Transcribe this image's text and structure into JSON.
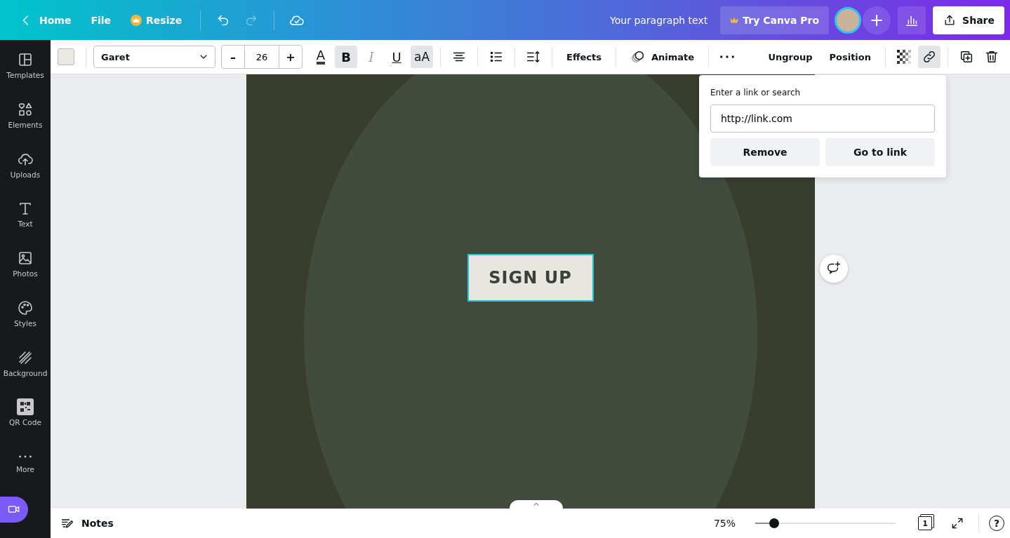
{
  "topbar": {
    "home": "Home",
    "file": "File",
    "resize": "Resize",
    "redo_disabled": true,
    "doc_title": "Your paragraph text",
    "pro_button": "Try Canva Pro",
    "add": "+",
    "share": "Share"
  },
  "sidebar": {
    "items": [
      {
        "label": "Templates"
      },
      {
        "label": "Elements"
      },
      {
        "label": "Uploads"
      },
      {
        "label": "Text"
      },
      {
        "label": "Photos"
      },
      {
        "label": "Styles"
      },
      {
        "label": "Background"
      },
      {
        "label": "QR Code"
      },
      {
        "label": "More"
      }
    ]
  },
  "toolbar": {
    "font": "Garet",
    "size": "26",
    "minus": "–",
    "plus": "+",
    "color_letter": "A",
    "bold": {
      "label": "B",
      "selected": true
    },
    "italic": {
      "label": "I",
      "disabled": true
    },
    "underline": {
      "label": "U",
      "selected": false
    },
    "case": {
      "label": "aA",
      "selected": true
    },
    "effects": "Effects",
    "animate": "Animate",
    "ungroup": "Ungroup",
    "position": "Position",
    "link_selected": true
  },
  "link_popup": {
    "label": "Enter a link or search",
    "value": "http://link.com",
    "buttons": [
      "Remove",
      "Go to link"
    ]
  },
  "canvas": {
    "button_text": "SIGN UP",
    "selected": true
  },
  "bottombar": {
    "notes": "Notes",
    "zoom": "75%",
    "zoom_level": {
      "level": 0.135
    },
    "page": "1",
    "help": "?"
  }
}
